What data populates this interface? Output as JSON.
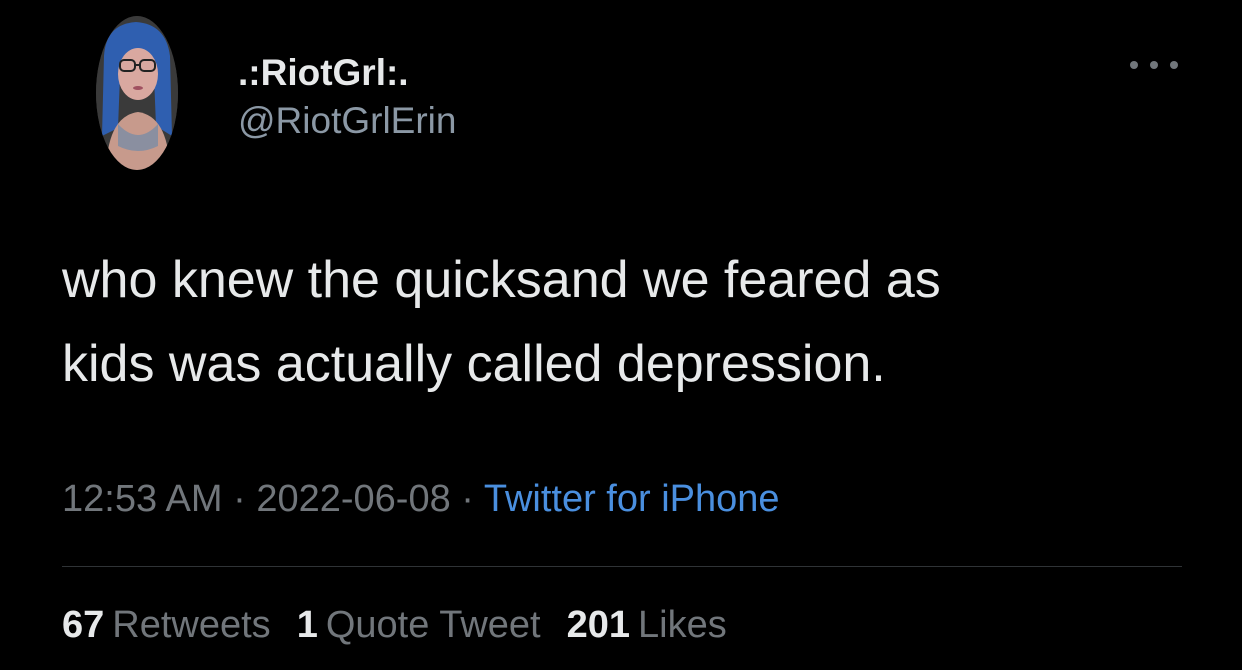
{
  "author": {
    "display_name": ".:RiotGrl:.",
    "handle": "@RiotGrlErin"
  },
  "tweet": {
    "text_line1": "who knew the quicksand we feared as",
    "text_line2": "kids was actually called depression."
  },
  "meta": {
    "time": "12:53 AM",
    "sep1": " · ",
    "date": "2022-06-08",
    "sep2": " · ",
    "source": "Twitter for iPhone"
  },
  "stats": {
    "retweets_count": "67",
    "retweets_label": "Retweets",
    "quotes_count": "1",
    "quotes_label": "Quote Tweet",
    "likes_count": "201",
    "likes_label": "Likes"
  },
  "colors": {
    "background": "#000000",
    "primary_text": "#e7e9ea",
    "secondary_text": "#71767b",
    "link": "#4a8fdf",
    "divider": "#2f3336"
  },
  "icons": {
    "more": "more-horizontal-icon"
  }
}
